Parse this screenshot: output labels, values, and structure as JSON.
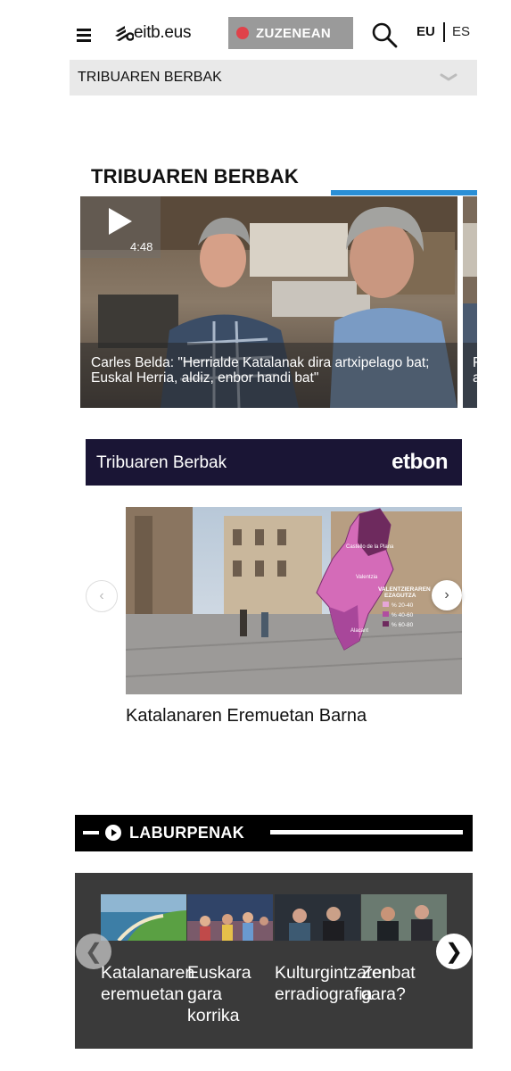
{
  "header": {
    "logo_text": "eitb.eus",
    "live_label": "ZUZENEAN",
    "lang_eu": "EU",
    "lang_es": "ES",
    "section_selector": "TRIBUAREN BERBAK"
  },
  "main": {
    "title": "TRIBUAREN BERBAK",
    "video": {
      "duration": "4:48",
      "caption": "Carles Belda: \"Herrialde Katalanak dira artxipelago bat; Euskal Herria, aldiz, enbor handi bat\"",
      "next_caption": "F a"
    }
  },
  "etbon": {
    "banner_title": "Tribuaren Berbak",
    "logo": "etbon",
    "carousel_title": "Katalanaren Eremuetan Barna",
    "map": {
      "city_1": "Castello de la Plana",
      "city_2": "Valentzia",
      "city_3": "Alacant",
      "legend_title_1": "VALENTZIERAREN",
      "legend_title_2": "EZAGUTZA",
      "legend_items": [
        "% 20-40",
        "% 40-60",
        "% 60-80"
      ]
    }
  },
  "laburpenak": {
    "title": "LABURPENAK",
    "items": [
      {
        "title": "Katalanaren eremuetan"
      },
      {
        "title": "Euskara gara korrika"
      },
      {
        "title": "Kulturgintzaren erradiografia"
      },
      {
        "title": "Zenbat gara?"
      }
    ]
  },
  "colors": {
    "live_dot": "#e0424a",
    "accent_blue": "#2a8fd6",
    "etbon_bg": "#1a1535",
    "panel_bg": "#3a3a3a"
  }
}
